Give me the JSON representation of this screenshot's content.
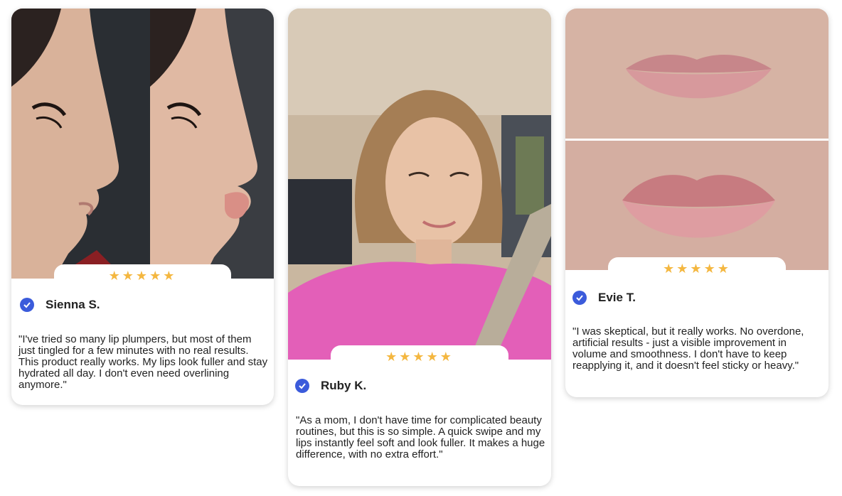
{
  "reviews": [
    {
      "name": "Sienna S.",
      "stars": "★★★★★",
      "rating": 5,
      "quote": "\"I've tried so many lip plumpers, but most of them just tingled for a few minutes with no real results. This product really works. My lips look fuller and stay hydrated all day. I don't even need overlining anymore.\""
    },
    {
      "name": "Ruby K.",
      "stars": "★★★★★",
      "rating": 5,
      "quote": "\"As a mom, I don't have time for complicated beauty routines, but this is so simple. A quick swipe and my lips instantly feel soft and look fuller. It makes a huge difference, with no extra effort.\""
    },
    {
      "name": "Evie T.",
      "stars": "★★★★★",
      "rating": 5,
      "quote": "\"I was skeptical, but it really works. No overdone, artificial results - just a visible improvement in volume and smoothness. I don't have to keep reapplying it, and it doesn't feel sticky or heavy.\""
    }
  ],
  "colors": {
    "star": "#f4b740",
    "check": "#3b5bdb",
    "text": "#222222"
  },
  "icons": {
    "verified": "check-circle-icon",
    "rating": "star-icon"
  }
}
